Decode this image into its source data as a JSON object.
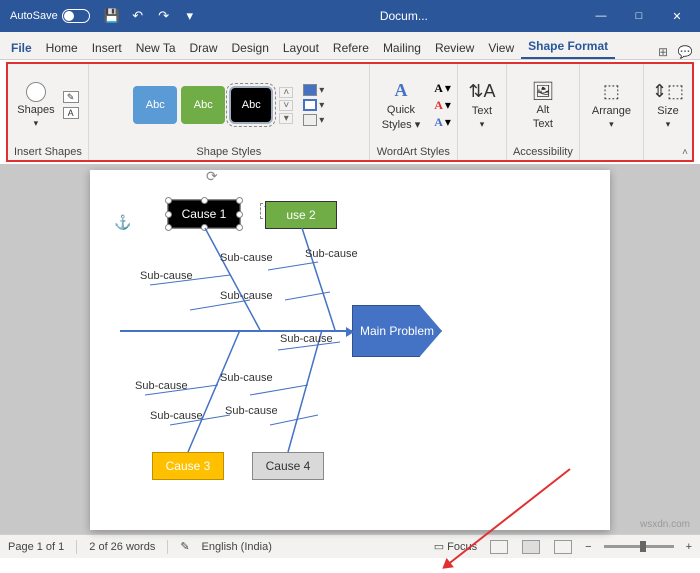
{
  "titlebar": {
    "autosave_label": "AutoSave",
    "doc_title": "Docum..."
  },
  "tabs": {
    "file": "File",
    "home": "Home",
    "insert": "Insert",
    "newtab": "New Ta",
    "draw": "Draw",
    "design": "Design",
    "layout": "Layout",
    "refere": "Refere",
    "mailing": "Mailing",
    "review": "Review",
    "view": "View",
    "shapeformat": "Shape Format"
  },
  "ribbon": {
    "insertshapes": {
      "label": "Insert Shapes",
      "shapes_btn": "Shapes"
    },
    "shapestyles": {
      "label": "Shape Styles",
      "abc": "Abc"
    },
    "wordart": {
      "label": "WordArt Styles",
      "quick": "Quick",
      "styles": "Styles"
    },
    "text": {
      "label": "Text",
      "btn": "Text"
    },
    "accessibility": {
      "label": "Accessibility",
      "alt": "Alt",
      "textlbl": "Text"
    },
    "arrange": {
      "label": "Arrange",
      "btn": "Arrange"
    },
    "size": {
      "label": "Size",
      "btn": "Size"
    }
  },
  "diagram": {
    "cause1": "Cause 1",
    "cause2": "use 2",
    "cause3": "Cause 3",
    "cause4": "Cause 4",
    "main_problem": "Main Problem",
    "subcause": "Sub-cause"
  },
  "statusbar": {
    "page": "Page 1 of 1",
    "words": "2 of 26 words",
    "lang": "English (India)",
    "focus": "Focus"
  },
  "watermark": "wsxdn.com"
}
